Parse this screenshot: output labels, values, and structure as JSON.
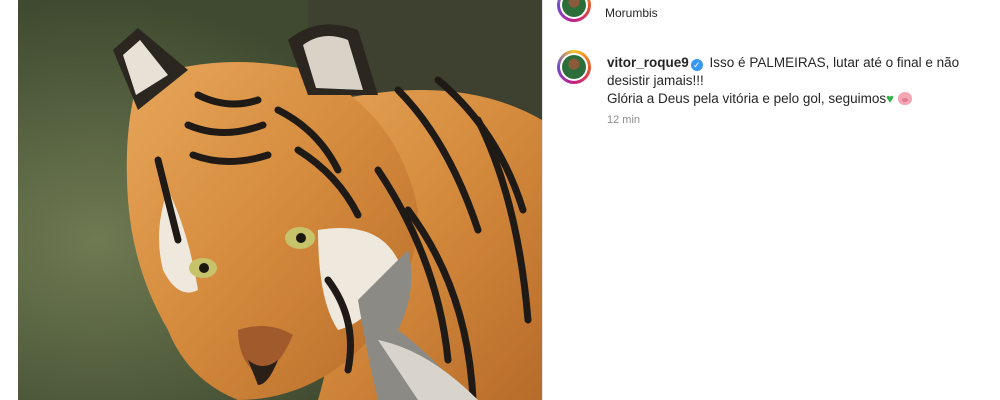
{
  "post": {
    "location": "Morumbis",
    "media": {
      "subject": "tiger-photo"
    }
  },
  "comment": {
    "username": "vitor_roque9",
    "text_line1": "Isso é PALMEIRAS, lutar até o final e não desistir jamais!!!",
    "text_line2": "Glória a Deus pela vitória e pelo gol, seguimos",
    "time": "12 min"
  },
  "icons": {
    "verified": "verified-badge-icon",
    "heart": "green-heart-icon",
    "pig": "pig-face-icon"
  },
  "colors": {
    "verified": "#3897f0",
    "heart": "#2fb34a",
    "meta_text": "#8e8e8e",
    "primary_text": "#262626"
  }
}
